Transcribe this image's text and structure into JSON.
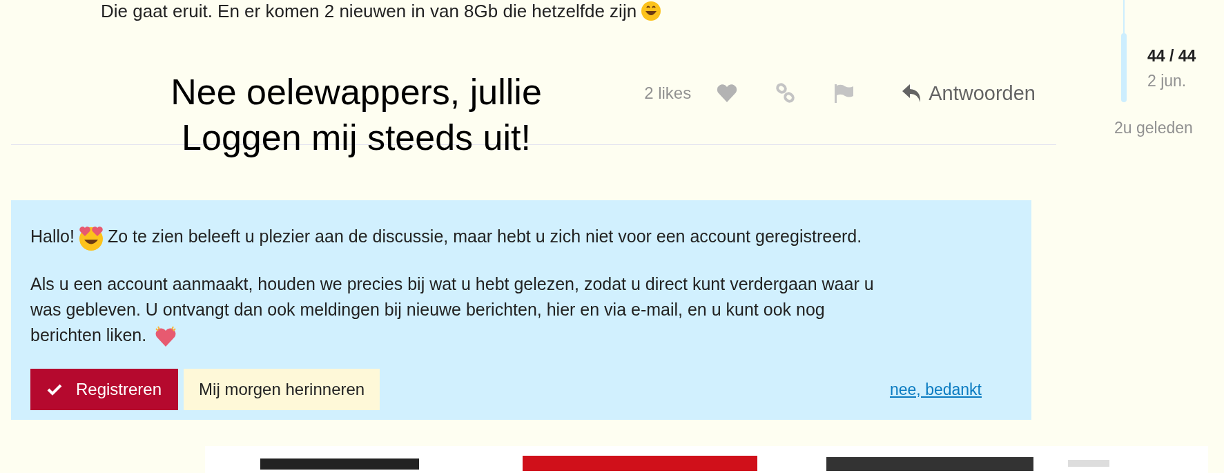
{
  "post": {
    "text": "Die gaat eruit. En er komen 2 nieuwen in van 8Gb die hetzelfde zijn",
    "image_text": [
      "Nee oelewappers, jullie",
      "Loggen mij steeds uit!"
    ],
    "likes": "2 likes",
    "reply": "Antwoorden"
  },
  "timeline": {
    "position": "44 / 44",
    "date": "2 jun.",
    "ago": "2u geleden"
  },
  "signup": {
    "greeting": "Hallo!",
    "intro": "Zo te zien beleeft u plezier aan de discussie, maar hebt u zich niet voor een account geregistreerd.",
    "body_lines": [
      "Als u een account aanmaakt, houden we precies bij wat u hebt gelezen, zodat u direct kunt verdergaan waar u",
      "was gebleven. U ontvangt dan ook meldingen bij nieuwe berichten, hier en via e-mail, en u kunt ook nog",
      "berichten liken."
    ],
    "buttons": [
      {
        "label": "Registreren",
        "kind": "primary"
      },
      {
        "label": "Mij morgen herinneren",
        "kind": "secondary"
      }
    ],
    "dismiss": "nee, bedankt"
  }
}
